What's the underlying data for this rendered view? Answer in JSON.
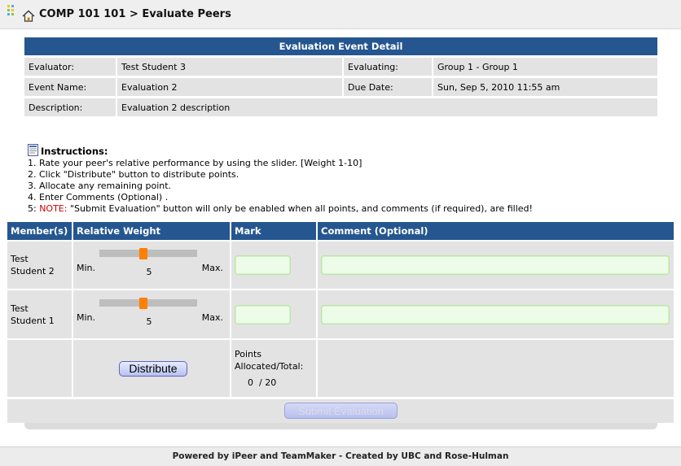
{
  "header": {
    "breadcrumb": "COMP 101 101 > Evaluate Peers",
    "icons": [
      "app-grid-icon",
      "home-icon"
    ]
  },
  "detail": {
    "title": "Evaluation Event Detail",
    "evaluator_label": "Evaluator:",
    "evaluator_value": "Test Student 3",
    "evaluating_label": "Evaluating:",
    "evaluating_value": "Group 1 - Group 1",
    "event_name_label": "Event Name:",
    "event_name_value": "Evaluation 2",
    "due_date_label": "Due Date:",
    "due_date_value": "Sun, Sep 5, 2010 11:55 am",
    "description_label": "Description:",
    "description_value": "Evaluation 2 description"
  },
  "instructions": {
    "heading": "Instructions:",
    "step1": "1. Rate your peer's relative performance by using the slider. [Weight 1-10]",
    "step2": "2. Click \"Distribute\" button to distribute points.",
    "step3": "3. Allocate any remaining point.",
    "step4": "4. Enter Comments (Optional) .",
    "step5_prefix": "5: ",
    "step5_note": "NOTE:",
    "step5_text": " \"Submit Evaluation\" button will only be enabled when all points, and comments (if required), are filled!"
  },
  "table": {
    "col_members": "Member(s)",
    "col_weight": "Relative Weight",
    "col_mark": "Mark",
    "col_comment": "Comment (Optional)"
  },
  "members": [
    {
      "name_line1": "Test",
      "name_line2": "Student 2",
      "weight": 5,
      "weight_min": 1,
      "weight_max": 10,
      "min_label": "Min.",
      "max_label": "Max.",
      "mark": "",
      "comment": ""
    },
    {
      "name_line1": "Test",
      "name_line2": "Student 1",
      "weight": 5,
      "weight_min": 1,
      "weight_max": 10,
      "min_label": "Min.",
      "max_label": "Max.",
      "mark": "",
      "comment": ""
    }
  ],
  "distribute_label": "Distribute",
  "points": {
    "label_line1": "Points",
    "label_line2": "Allocated/Total:",
    "allocated": "0",
    "separator": "/",
    "total": "20"
  },
  "submit_label": "Submit Evaluation",
  "footer": "Powered by iPeer and TeamMaker - Created by UBC and Rose-Hulman",
  "colors": {
    "header_blue": "#25568f",
    "row_gray": "#e3e3e3",
    "slider_thumb": "#ff7f00",
    "note_red": "#cc0000",
    "field_green": "#edfce9"
  }
}
